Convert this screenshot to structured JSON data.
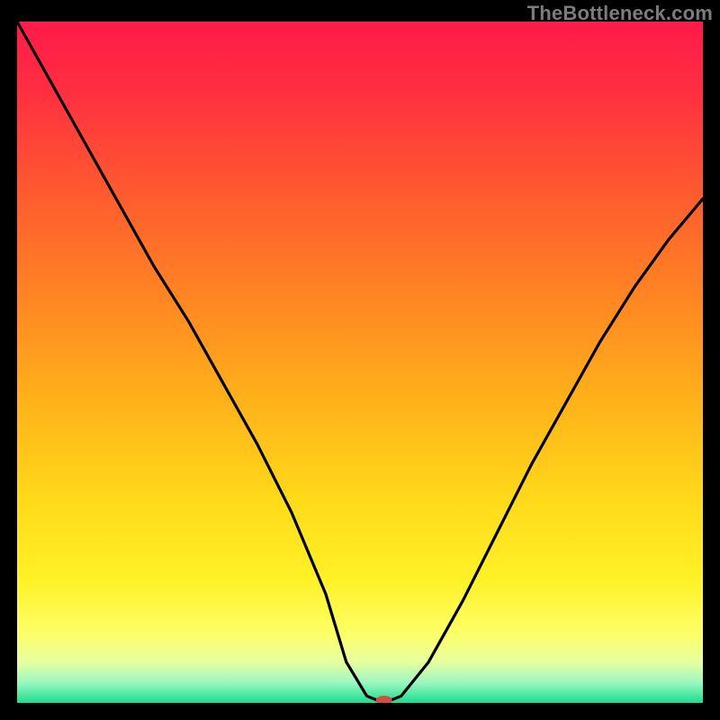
{
  "attribution": "TheBottleneck.com",
  "chart_data": {
    "type": "line",
    "title": "",
    "xlabel": "",
    "ylabel": "",
    "xlim": [
      0,
      100
    ],
    "ylim": [
      0,
      100
    ],
    "grid": false,
    "legend": false,
    "background_gradient": {
      "stops": [
        {
          "pos": 0.0,
          "color": "#ff1b49"
        },
        {
          "pos": 0.1,
          "color": "#ff2e41"
        },
        {
          "pos": 0.25,
          "color": "#ff5a2f"
        },
        {
          "pos": 0.4,
          "color": "#ff8423"
        },
        {
          "pos": 0.55,
          "color": "#ffb01a"
        },
        {
          "pos": 0.7,
          "color": "#ffd91a"
        },
        {
          "pos": 0.82,
          "color": "#fff227"
        },
        {
          "pos": 0.9,
          "color": "#fdff6a"
        },
        {
          "pos": 0.94,
          "color": "#e7ffa0"
        },
        {
          "pos": 0.97,
          "color": "#9cf7c1"
        },
        {
          "pos": 1.0,
          "color": "#1bdc8f"
        }
      ]
    },
    "series": [
      {
        "name": "bottleneck-curve",
        "x": [
          0,
          5,
          10,
          15,
          20,
          25,
          30,
          35,
          40,
          45,
          48,
          51,
          53.5,
          56,
          60,
          65,
          70,
          75,
          80,
          85,
          90,
          95,
          100
        ],
        "values": [
          100,
          91,
          82,
          73,
          64,
          56,
          47,
          38,
          28,
          16,
          6,
          1,
          0,
          1,
          6,
          15,
          25,
          35,
          44,
          53,
          61,
          68,
          74
        ]
      }
    ],
    "marker": {
      "name": "optimum-marker",
      "x": 53.5,
      "y": 0,
      "color": "#cf4f42",
      "rx": 9,
      "ry": 5
    }
  }
}
